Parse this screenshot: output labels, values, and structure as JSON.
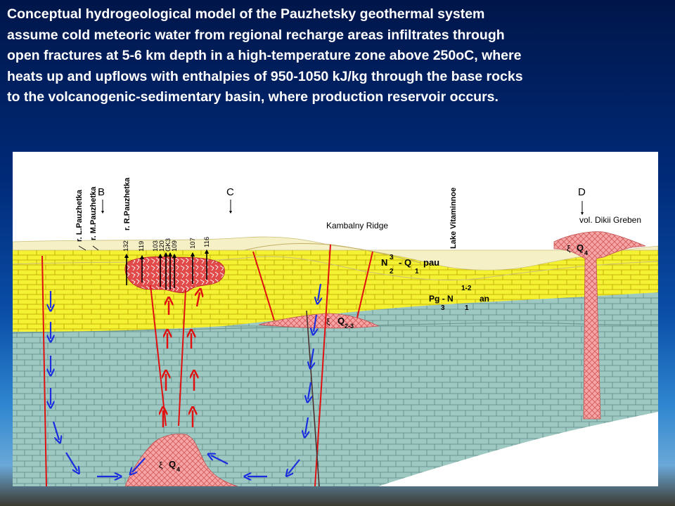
{
  "title": {
    "lines": [
      "Conceptual hydrogeological model of the Pauzhetsky geothermal system",
      "assume cold meteoric water from regional recharge areas infiltrates through",
      "open fractures at 5-6 km depth in a high-temperature zone above 250oC, where",
      "heats up and upflows with enthalpies of 950-1050 kJ/kg through the base rocks",
      "to the volcanogenic-sedimentary basin, where production reservoir occurs."
    ]
  },
  "diagram": {
    "sections": {
      "b": "B",
      "c": "C",
      "d": "D"
    },
    "rivers": {
      "l_pauzhetka": "r. L.Pauzhetka",
      "m_pauzhetka": "r. M.Pauzhetka",
      "r_pauzhetka": "r. R.Pauzhetka"
    },
    "places": {
      "kambalny": "Kambalny Ridge",
      "lake": "Lake Vitaminnoe",
      "dikii": "vol. Dikii Greben"
    },
    "wells": [
      "132",
      "119",
      "103",
      "120",
      "GK3",
      "109",
      "107",
      "116"
    ],
    "units": {
      "nq_main": "N",
      "nq_sub": "2",
      "nq_sup": "3",
      "nq_rest": "- Q",
      "nq_sub2": "1",
      "nq_tail": "pau",
      "pg_main": "Pg - N",
      "pg_sub": "3",
      "pg_sup": "1-2",
      "pg_sub2": "1",
      "pg_tail": "an",
      "xi": "ξ",
      "q4": "Q",
      "q4_sub": "4",
      "q23": "Q",
      "q23_sub": "2-3"
    },
    "colors": {
      "sediment_yellow": "#f5f233",
      "basement_teal": "#9ec8c2",
      "intrusion_pink": "#f2a0a0",
      "upper_cover": "#f6f0c6",
      "fault_red": "#e01010",
      "recharge_blue": "#1a2ee0"
    }
  }
}
